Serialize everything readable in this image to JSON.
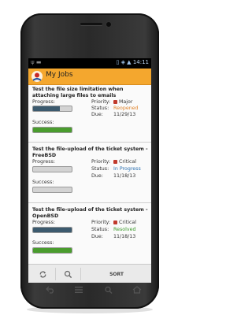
{
  "status_bar": {
    "left_icons": "ψ ▬",
    "right_icons": "▯ ◈ ▲",
    "time": "14:11"
  },
  "app_bar": {
    "title": "My Jobs",
    "logo_icon": "app-logo-icon",
    "accent_color": "#f4a72e"
  },
  "labels": {
    "progress": "Progress:",
    "success": "Success:",
    "priority": "Priority:",
    "status": "Status:",
    "due": "Due:"
  },
  "jobs": [
    {
      "title": "Test the file size limitation when attaching large files to emails",
      "priority": "Major",
      "status": "Reopened",
      "status_color": "#e0832a",
      "due": "11/29/13",
      "progress": 0.7,
      "success": 1.0
    },
    {
      "title": "Test the file-upload of the ticket system - FreeBSD",
      "priority": "Critical",
      "status": "In Progress",
      "status_color": "#2a6fb0",
      "due": "11/18/13",
      "progress": 0.0,
      "success": 0.0
    },
    {
      "title": "Test the file-upload of the ticket system - OpenBSD",
      "priority": "Critical",
      "status": "Resolved",
      "status_color": "#3c9a2b",
      "due": "11/18/13",
      "progress": 1.0,
      "success": 1.0
    }
  ],
  "toolbar": {
    "refresh_icon": "refresh-icon",
    "search_icon": "search-icon",
    "sort_label": "SORT"
  },
  "colors": {
    "progress_fill": "#3c5a6e",
    "success_fill": "#4a9c2e"
  }
}
